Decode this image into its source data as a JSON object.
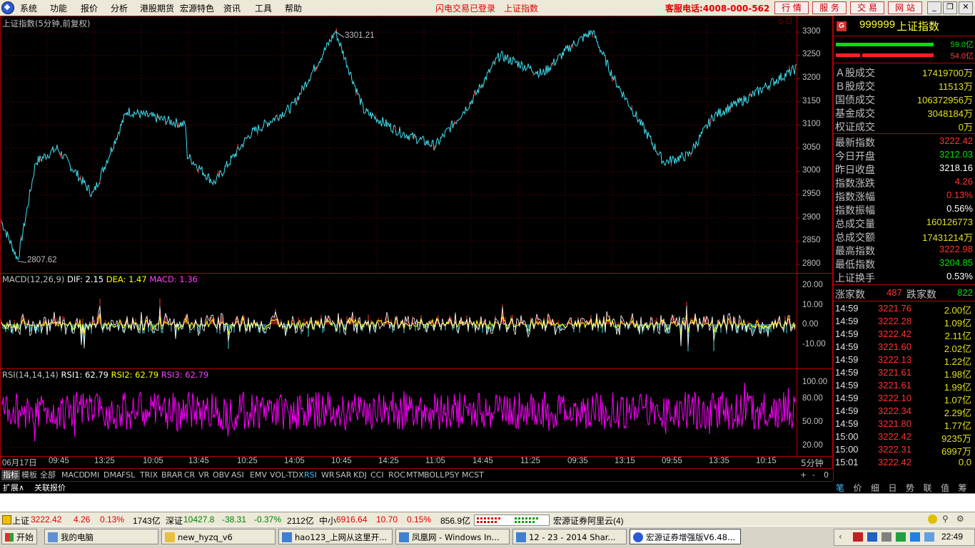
{
  "menu": {
    "items": [
      "系统",
      "功能",
      "报价",
      "分析",
      "港股期货",
      "宏源特色",
      "资讯",
      "工具",
      "帮助"
    ],
    "flash_trade": "闪电交易已登录",
    "index_name": "上证指数",
    "hotline": "客服电话:4008-000-562",
    "buttons": [
      "行 情",
      "服 务",
      "交 易",
      "网 站"
    ],
    "window_controls": [
      "_",
      "❐",
      "✕"
    ]
  },
  "main_panel": {
    "title": "上证指数(5分钟,前复权)",
    "high_label": "3301.21",
    "low_label": "2807.62",
    "y_ticks": [
      "3300",
      "3250",
      "3200",
      "3150",
      "3100",
      "3050",
      "3000",
      "2950",
      "2900",
      "2850",
      "2800"
    ]
  },
  "macd_panel": {
    "name": "MACD(12,26,9)",
    "dif": "DIF: 2.15",
    "dea": "DEA: 1.47",
    "macd": "MACD: 1.36",
    "y_ticks": [
      "20.00",
      "10.00",
      "0.00",
      "-10.00"
    ]
  },
  "rsi_panel": {
    "name": "RSI(14,14,14)",
    "rsi1": "RSI1: 62.79",
    "rsi2": "RSI2: 62.79",
    "rsi3": "RSI3: 62.79",
    "y_ticks": [
      "100.00",
      "80.00",
      "50.00",
      "20.00"
    ]
  },
  "time_axis": {
    "labels": [
      "06月17日",
      "09:45",
      "13:25",
      "10:05",
      "13:45",
      "10:25",
      "14:05",
      "10:45",
      "14:25",
      "11:05",
      "14:45",
      "11:25",
      "09:35",
      "13:15",
      "09:55",
      "13:35",
      "10:15"
    ],
    "period": "5分钟"
  },
  "indicator_tabs": [
    "指标",
    "模板",
    "全部",
    "MACD",
    "DMI",
    "DMA",
    "FSL",
    "TRIX",
    "BRAR",
    "CR",
    "VR",
    "OBV",
    "ASI",
    "EMV",
    "VOL-TDX",
    "RSI",
    "WR",
    "SAR",
    "KDJ",
    "CCI",
    "ROC",
    "MTM",
    "BOLL",
    "PSY",
    "MCST"
  ],
  "indicator_tab_controls": [
    "+",
    "-",
    "0"
  ],
  "ext_tabs": [
    "扩展∧",
    "关联报价"
  ],
  "right_panel": {
    "badge": "G",
    "code": "999999",
    "name": "上证指数",
    "up_volume": "59.0亿",
    "down_volume": "54.0亿",
    "trade_rows": [
      {
        "label": "Ａ股成交",
        "value": "17419700万",
        "color": "#e0e020"
      },
      {
        "label": "Ｂ股成交",
        "value": "11513万",
        "color": "#e0e020"
      },
      {
        "label": "国债成交",
        "value": "106372956万",
        "color": "#e0e020"
      },
      {
        "label": "基金成交",
        "value": "3048184万",
        "color": "#e0e020"
      },
      {
        "label": "权证成交",
        "value": "0万",
        "color": "#e0e020"
      }
    ],
    "stat_rows": [
      {
        "label": "最新指数",
        "value": "3222.42",
        "color": "#ff3232"
      },
      {
        "label": "今日开盘",
        "value": "3212.03",
        "color": "#00e000"
      },
      {
        "label": "昨日收盘",
        "value": "3218.16",
        "color": "#ffffff"
      },
      {
        "label": "指数涨跌",
        "value": "4.26",
        "color": "#ff3232"
      },
      {
        "label": "指数涨幅",
        "value": "0.13%",
        "color": "#ff3232"
      },
      {
        "label": "指数振幅",
        "value": "0.56%",
        "color": "#ffffff"
      },
      {
        "label": "总成交量",
        "value": "160126773",
        "color": "#e0e020"
      },
      {
        "label": "总成交额",
        "value": "17431214万",
        "color": "#e0e020"
      },
      {
        "label": "最高指数",
        "value": "3222.98",
        "color": "#ff3232"
      },
      {
        "label": "最低指数",
        "value": "3204.85",
        "color": "#00e000"
      },
      {
        "label": "上证换手",
        "value": "0.53%",
        "color": "#ffffff"
      }
    ],
    "up_count_label": "涨家数",
    "up_count": "487",
    "down_count_label": "跌家数",
    "down_count": "822",
    "ticks": [
      {
        "time": "14:59",
        "price": "3221.76",
        "vol": "2.00亿"
      },
      {
        "time": "14:59",
        "price": "3222.28",
        "vol": "1.09亿"
      },
      {
        "time": "14:59",
        "price": "3222.42",
        "vol": "2.11亿"
      },
      {
        "time": "14:59",
        "price": "3221.60",
        "vol": "2.02亿"
      },
      {
        "time": "14:59",
        "price": "3222.13",
        "vol": "1.22亿"
      },
      {
        "time": "14:59",
        "price": "3221.61",
        "vol": "1.98亿"
      },
      {
        "time": "14:59",
        "price": "3221.61",
        "vol": "1.99亿"
      },
      {
        "time": "14:59",
        "price": "3222.10",
        "vol": "1.07亿"
      },
      {
        "time": "14:59",
        "price": "3222.34",
        "vol": "2.29亿"
      },
      {
        "time": "14:59",
        "price": "3221.80",
        "vol": "1.77亿"
      },
      {
        "time": "15:00",
        "price": "3222.42",
        "vol": "9235万"
      },
      {
        "time": "15:00",
        "price": "3222.31",
        "vol": "6997万"
      },
      {
        "time": "15:01",
        "price": "3222.42",
        "vol": "0.0"
      }
    ],
    "bottom_tabs": [
      "笔",
      "价",
      "细",
      "日",
      "势",
      "联",
      "值",
      "筹"
    ]
  },
  "status_bar": {
    "sh_name": "上证",
    "sh_price": "3222.42",
    "sh_change": "4.26",
    "sh_pct": "0.13%",
    "sh_amount": "1743亿",
    "sz_name": "深证",
    "sz_price": "10427.8",
    "sz_change": "-38.31",
    "sz_pct": "-0.37%",
    "sz_amount": "2112亿",
    "zx_name": "中小",
    "zx_price": "6916.64",
    "zx_change": "10.70",
    "zx_pct": "0.15%",
    "zx_amount": "856.9亿",
    "server": "宏源证券阿里云(4)"
  },
  "taskbar": {
    "start": "开始",
    "tasks": [
      "我的电脑",
      "new_hyzq_v6",
      "hao123_上网从这里开...",
      "凤凰网 - Windows In...",
      "12 - 23 - 2014 Shar...",
      "宏源证券增强版V6.48..."
    ],
    "clock": "22:49"
  },
  "colors": {
    "up": "#ff3232",
    "down": "#00e000",
    "price_line": "#40e0f0",
    "grid": "#700000",
    "rsi": "#ff00ff",
    "dif": "#ffffff",
    "dea": "#ffff00"
  }
}
